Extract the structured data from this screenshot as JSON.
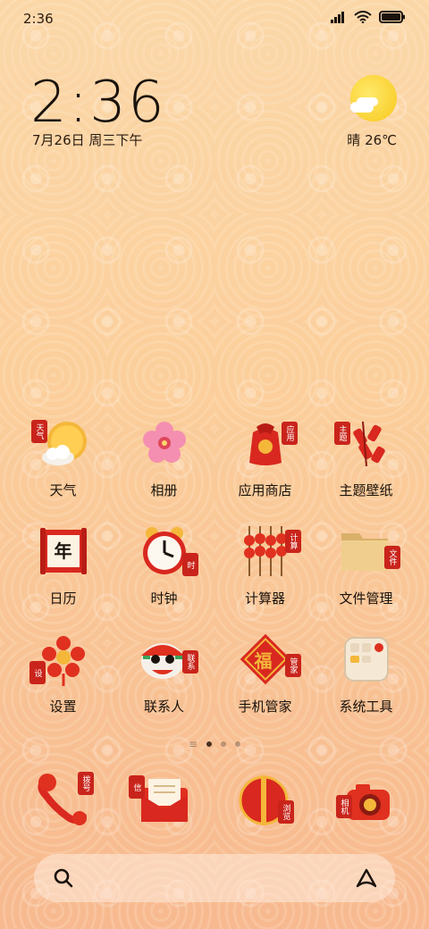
{
  "status_bar": {
    "time": "2:36"
  },
  "clock": {
    "time": "2:36",
    "date": "7月26日 周三下午"
  },
  "weather": {
    "text": "晴 26℃",
    "icon": "sun-cloud-icon"
  },
  "apps": [
    {
      "label": "天气",
      "icon": "weather-icon"
    },
    {
      "label": "相册",
      "icon": "gallery-icon"
    },
    {
      "label": "应用商店",
      "icon": "app-store-icon"
    },
    {
      "label": "主题壁纸",
      "icon": "themes-icon"
    },
    {
      "label": "日历",
      "icon": "calendar-icon"
    },
    {
      "label": "时钟",
      "icon": "clock-icon"
    },
    {
      "label": "计算器",
      "icon": "calculator-icon"
    },
    {
      "label": "文件管理",
      "icon": "file-manager-icon"
    },
    {
      "label": "设置",
      "icon": "settings-icon"
    },
    {
      "label": "联系人",
      "icon": "contacts-icon"
    },
    {
      "label": "手机管家",
      "icon": "security-icon"
    },
    {
      "label": "系统工具",
      "icon": "system-tools-icon"
    }
  ],
  "seals": [
    "天气",
    "应用",
    "主题",
    "时",
    "计算",
    "文件",
    "设",
    "联系",
    "管家",
    "拨号",
    "信",
    "浏览",
    "相机"
  ],
  "calendar_glyph": "年",
  "security_glyph": "福",
  "dock": [
    {
      "icon": "phone-icon"
    },
    {
      "icon": "messages-icon"
    },
    {
      "icon": "browser-icon"
    },
    {
      "icon": "camera-icon"
    }
  ],
  "page_indicator": {
    "pages": 3,
    "active": 0
  },
  "colors": {
    "accent": "#c9241b",
    "gold": "#f4b73a",
    "text": "#1a120c"
  }
}
